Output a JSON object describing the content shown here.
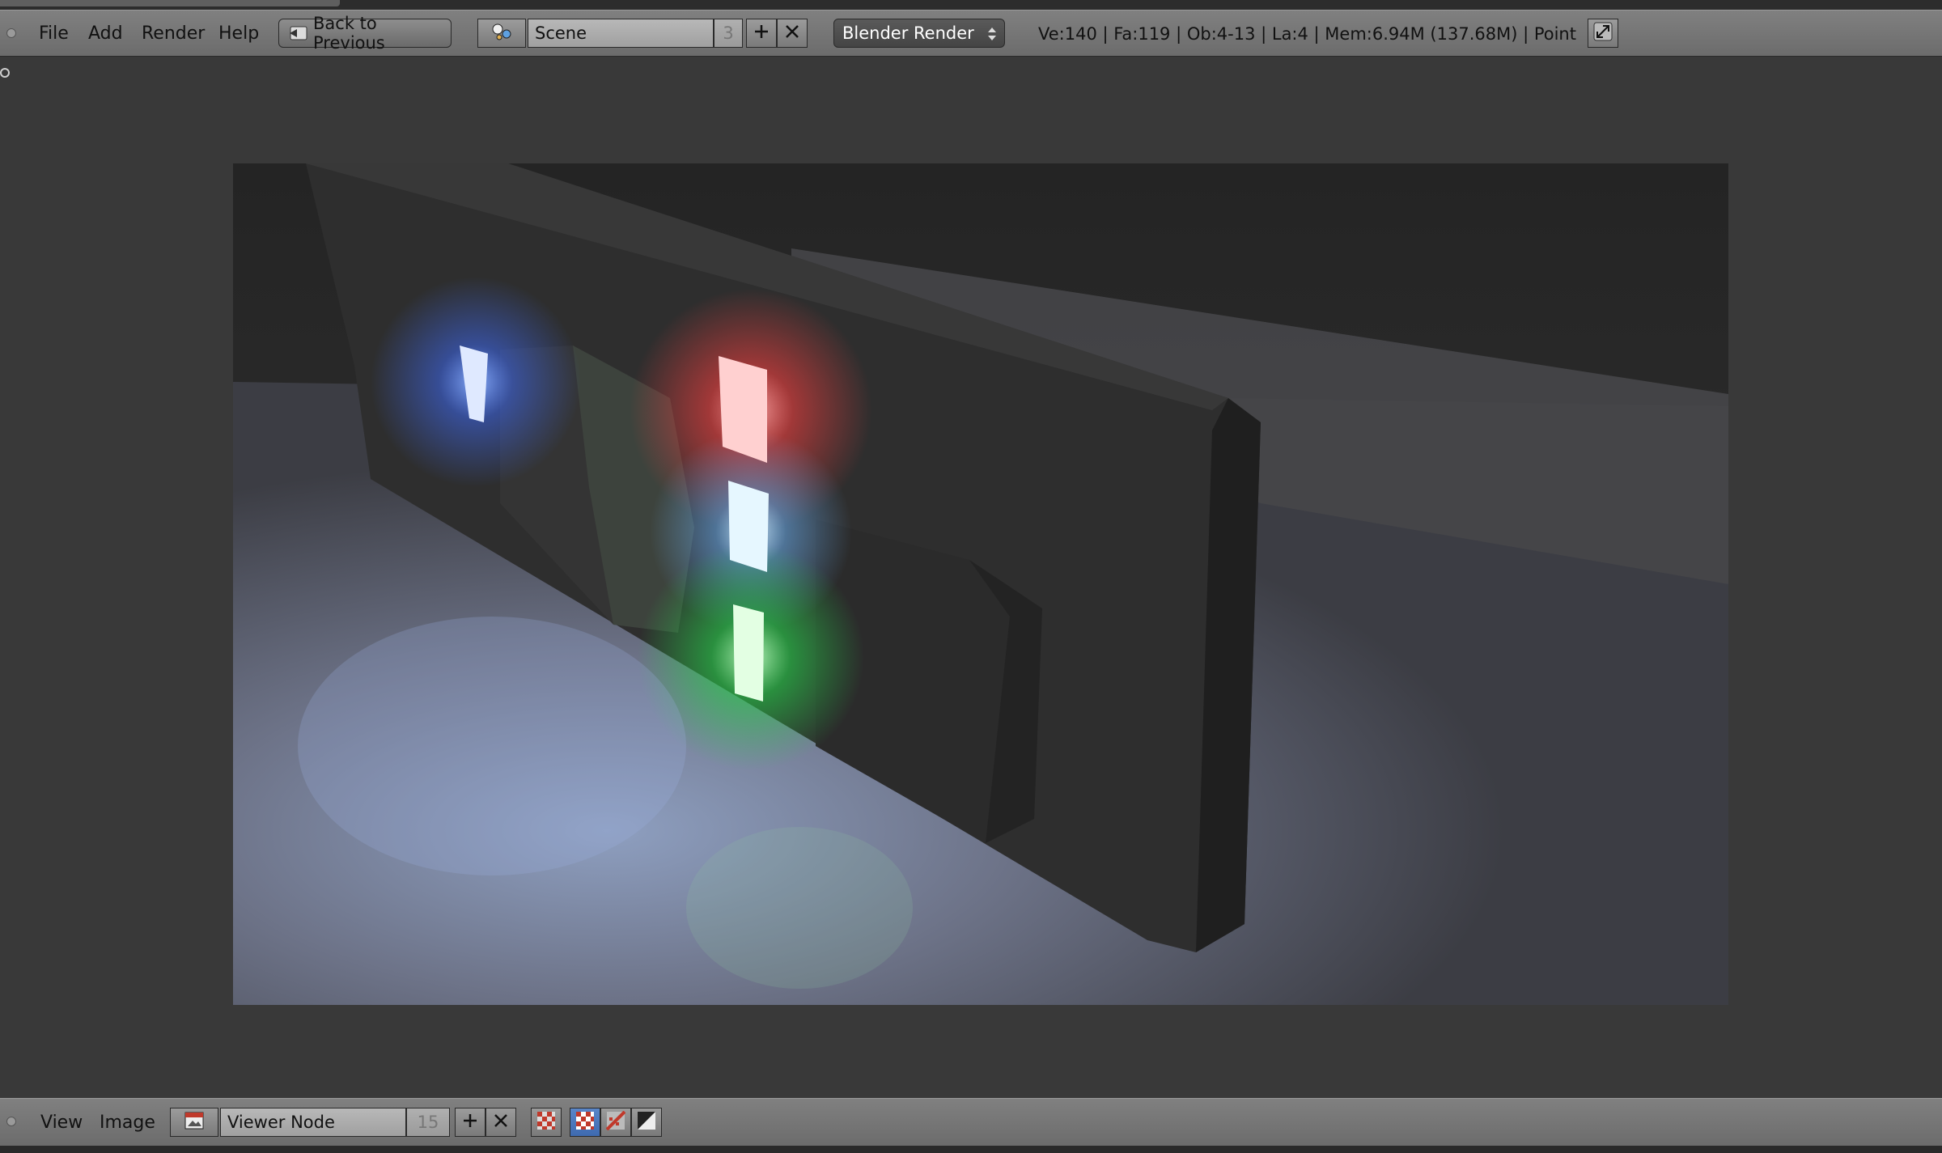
{
  "top_header": {
    "menus": [
      "File",
      "Add",
      "Render",
      "Help"
    ],
    "back_button": "Back to Previous",
    "scene": {
      "name": "Scene",
      "users": "3"
    },
    "render_engine": "Blender Render",
    "stats": "Ve:140 | Fa:119 | Ob:4-13 | La:4 | Mem:6.94M (137.68M) | Point"
  },
  "bottom_header": {
    "menus": [
      "View",
      "Image"
    ],
    "image": {
      "name": "Viewer Node",
      "users": "15"
    }
  },
  "viewport": {
    "content": "rendered-3d-image",
    "light_colors": {
      "blue": "#4a7bff",
      "red": "#ff4a4a",
      "cyan": "#7fd4ff",
      "green": "#2fd64a"
    }
  },
  "icons": [
    "scene-icon",
    "image-icon",
    "add-icon",
    "close-icon",
    "expand-icon",
    "back-arrow-icon",
    "dropdown-arrows-icon"
  ]
}
